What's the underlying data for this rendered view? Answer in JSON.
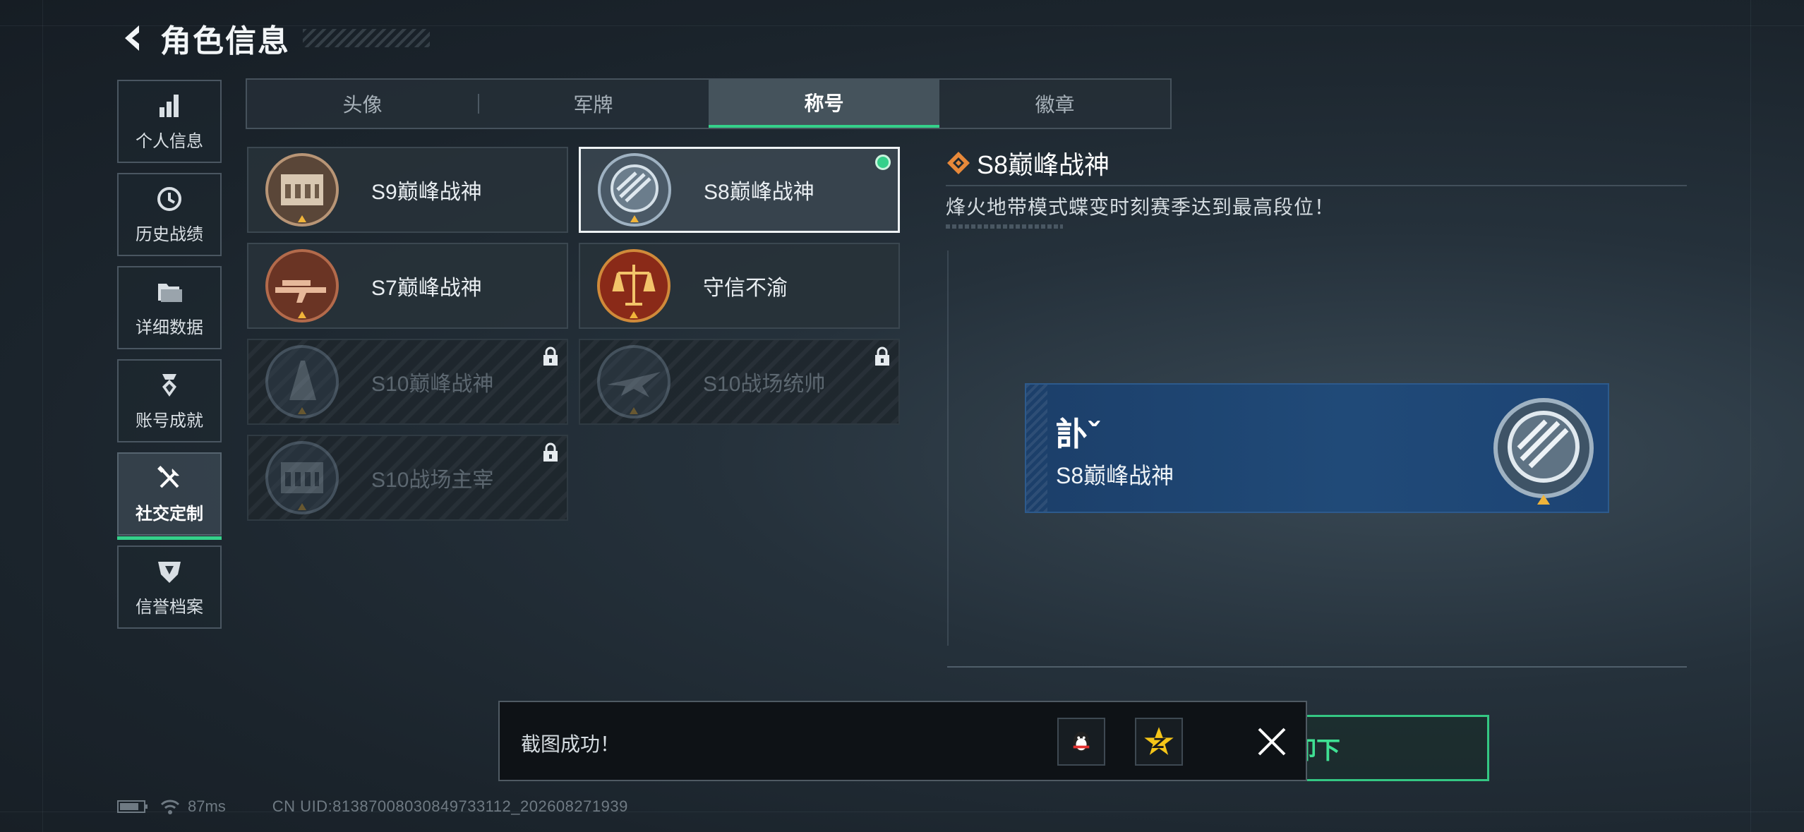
{
  "header": {
    "title": "角色信息"
  },
  "sidebar": {
    "items": [
      {
        "label": "个人信息",
        "icon": "bar-chart-icon",
        "active": false
      },
      {
        "label": "历史战绩",
        "icon": "clock-icon",
        "active": false
      },
      {
        "label": "详细数据",
        "icon": "folder-icon",
        "active": false
      },
      {
        "label": "账号成就",
        "icon": "medal-icon",
        "active": false
      },
      {
        "label": "社交定制",
        "icon": "tools-icon",
        "active": true
      },
      {
        "label": "信誉档案",
        "icon": "shield-icon",
        "active": false
      }
    ]
  },
  "tabs": [
    {
      "label": "头像",
      "active": false
    },
    {
      "label": "军牌",
      "active": false
    },
    {
      "label": "称号",
      "active": true
    },
    {
      "label": "徽章",
      "active": false
    }
  ],
  "titles": [
    {
      "name": "S9巅峰战神",
      "badge": "colosseum-badge-icon",
      "state": "owned"
    },
    {
      "name": "S8巅峰战神",
      "badge": "wing-emblem-badge-icon",
      "state": "selected"
    },
    {
      "name": "S7巅峰战神",
      "badge": "rifle-badge-icon",
      "state": "owned"
    },
    {
      "name": "守信不渝",
      "badge": "scales-badge-icon",
      "state": "owned"
    },
    {
      "name": "S10巅峰战神",
      "badge": "tower-badge-icon",
      "state": "locked"
    },
    {
      "name": "S10战场统帅",
      "badge": "jet-badge-icon",
      "state": "locked"
    },
    {
      "name": "S10战场主宰",
      "badge": "colosseum-badge-icon",
      "state": "locked"
    }
  ],
  "detail": {
    "title": "S8巅峰战神",
    "description": "烽火地带模式蝶变时刻赛季达到最高段位！"
  },
  "preview": {
    "player_name": "訃ˇ",
    "title": "S8巅峰战神"
  },
  "unequip_button": {
    "label": "卸下"
  },
  "toast": {
    "message": "截图成功！",
    "share_targets": [
      "qq-icon",
      "qzone-icon"
    ]
  },
  "status_bar": {
    "ping": "87ms",
    "uid": "CN UID:81387008030849733112_202608271939"
  },
  "colors": {
    "accent_green": "#35d08a",
    "preview_blue": "#204a78",
    "diamond_orange": "#e8893a"
  }
}
